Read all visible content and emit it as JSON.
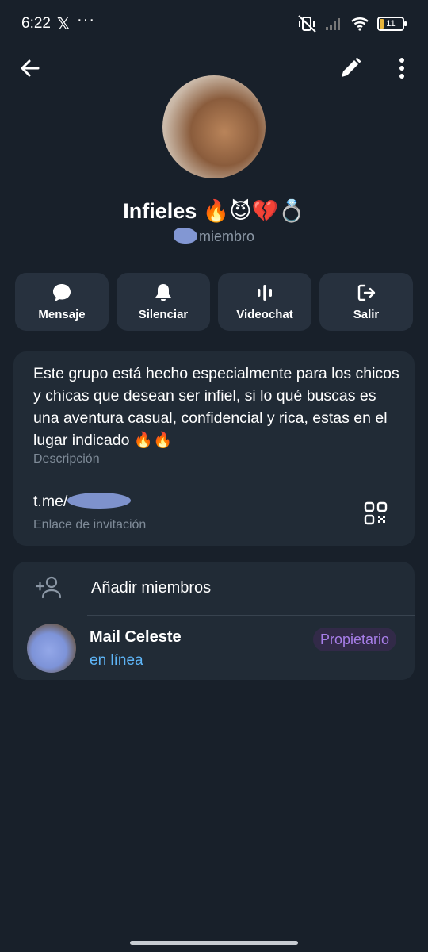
{
  "status_bar": {
    "time": "6:22",
    "x_app": "𝕏",
    "more_dots": "···",
    "battery": "11"
  },
  "group": {
    "title": "Infieles 🔥😈💔💍",
    "subtitle": "miembro"
  },
  "actions": [
    {
      "label": "Mensaje",
      "icon": "chat-bubble-icon"
    },
    {
      "label": "Silenciar",
      "icon": "bell-icon"
    },
    {
      "label": "Videochat",
      "icon": "voice-bars-icon"
    },
    {
      "label": "Salir",
      "icon": "logout-icon"
    }
  ],
  "description": {
    "text": "Este grupo está hecho especialmente para los chicos y chicas que desean ser infiel, si lo qué buscas es una aventura casual, confidencial y rica, estas en el lugar indicado 🔥🔥",
    "caption": "Descripción"
  },
  "invite": {
    "link_prefix": "t.me/",
    "caption": "Enlace de invitación"
  },
  "members": {
    "add_label": "Añadir miembros",
    "list": [
      {
        "name": "Mail Celeste",
        "status": "en línea",
        "role": "Propietario"
      }
    ]
  },
  "colors": {
    "background": "#18202a",
    "card": "#212b36",
    "button": "#27313e",
    "online": "#5eb5f7",
    "owner_badge_text": "#a77ee8",
    "owner_badge_bg": "#322a48"
  }
}
